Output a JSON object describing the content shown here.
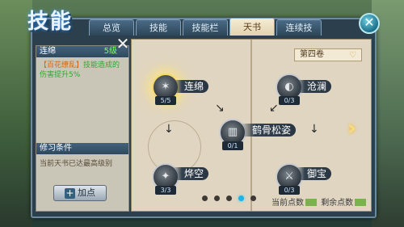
{
  "window": {
    "title": "技能",
    "tabs": [
      {
        "label": "总览",
        "active": false
      },
      {
        "label": "技能",
        "active": false
      },
      {
        "label": "技能栏",
        "active": false
      },
      {
        "label": "天书",
        "active": true
      },
      {
        "label": "连续技",
        "active": false
      }
    ]
  },
  "detail": {
    "name": "连绵",
    "level": "5级",
    "desc_highlight": "【百花缭乱】",
    "desc_rest": "技能造成的伤害提升5%",
    "condition_header": "修习条件",
    "condition_text": "当前天书已达最高级别",
    "add_button": "加点"
  },
  "book": {
    "volume": "第四卷",
    "nodes": [
      {
        "name": "连绵",
        "count": "5/5"
      },
      {
        "name": "沧澜",
        "count": "0/3"
      },
      {
        "name": "鹤骨松姿",
        "count": "0/1"
      },
      {
        "name": "烨空",
        "count": "3/3"
      },
      {
        "name": "御宝",
        "count": "0/3"
      }
    ],
    "page_index": 4,
    "pages": 5,
    "current_points_label": "当前点数",
    "remaining_points_label": "剩余点数"
  },
  "colors": {
    "accent": "#1fb2e6",
    "level": "#7bff6a",
    "highlight": "#d06a16",
    "desc": "#2ea82e"
  },
  "icons": [
    "close-icon",
    "plus-icon",
    "heart-icon",
    "chevron-right-icon"
  ]
}
